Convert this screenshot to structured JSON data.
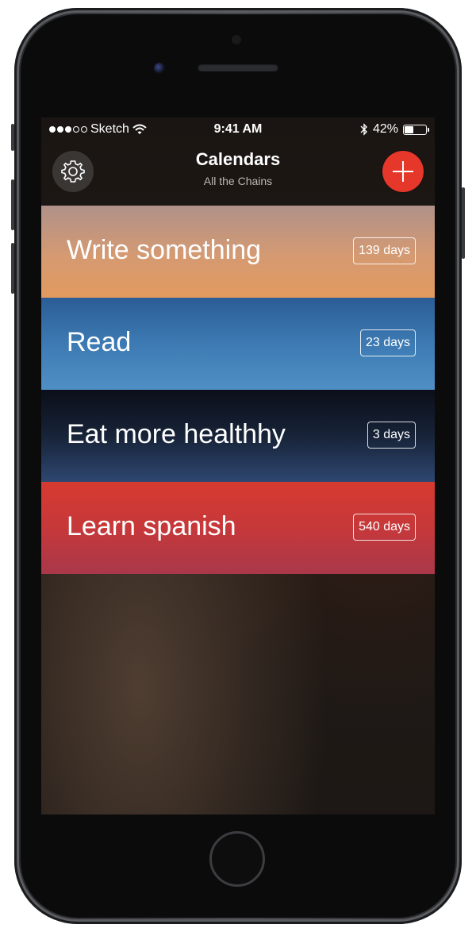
{
  "status_bar": {
    "carrier": "Sketch",
    "time": "9:41 AM",
    "battery_percent": "42%",
    "battery_level": 0.42,
    "signal_bars": 3,
    "icons": [
      "wifi-icon",
      "bluetooth-icon",
      "battery-icon"
    ]
  },
  "nav": {
    "title": "Calendars",
    "subtitle": "All the Chains",
    "left_icon": "gear-icon",
    "right_icon": "plus-icon"
  },
  "chains": [
    {
      "name": "Write something",
      "days": "139 days"
    },
    {
      "name": "Read",
      "days": "23 days"
    },
    {
      "name": "Eat more healthhy",
      "days": "3 days"
    },
    {
      "name": "Learn spanish",
      "days": "540 days"
    }
  ],
  "colors": {
    "accent_add": "#e5382a",
    "chain_colors": [
      "#d59a72",
      "#3d7ab3",
      "#172338",
      "#c6383a"
    ]
  }
}
